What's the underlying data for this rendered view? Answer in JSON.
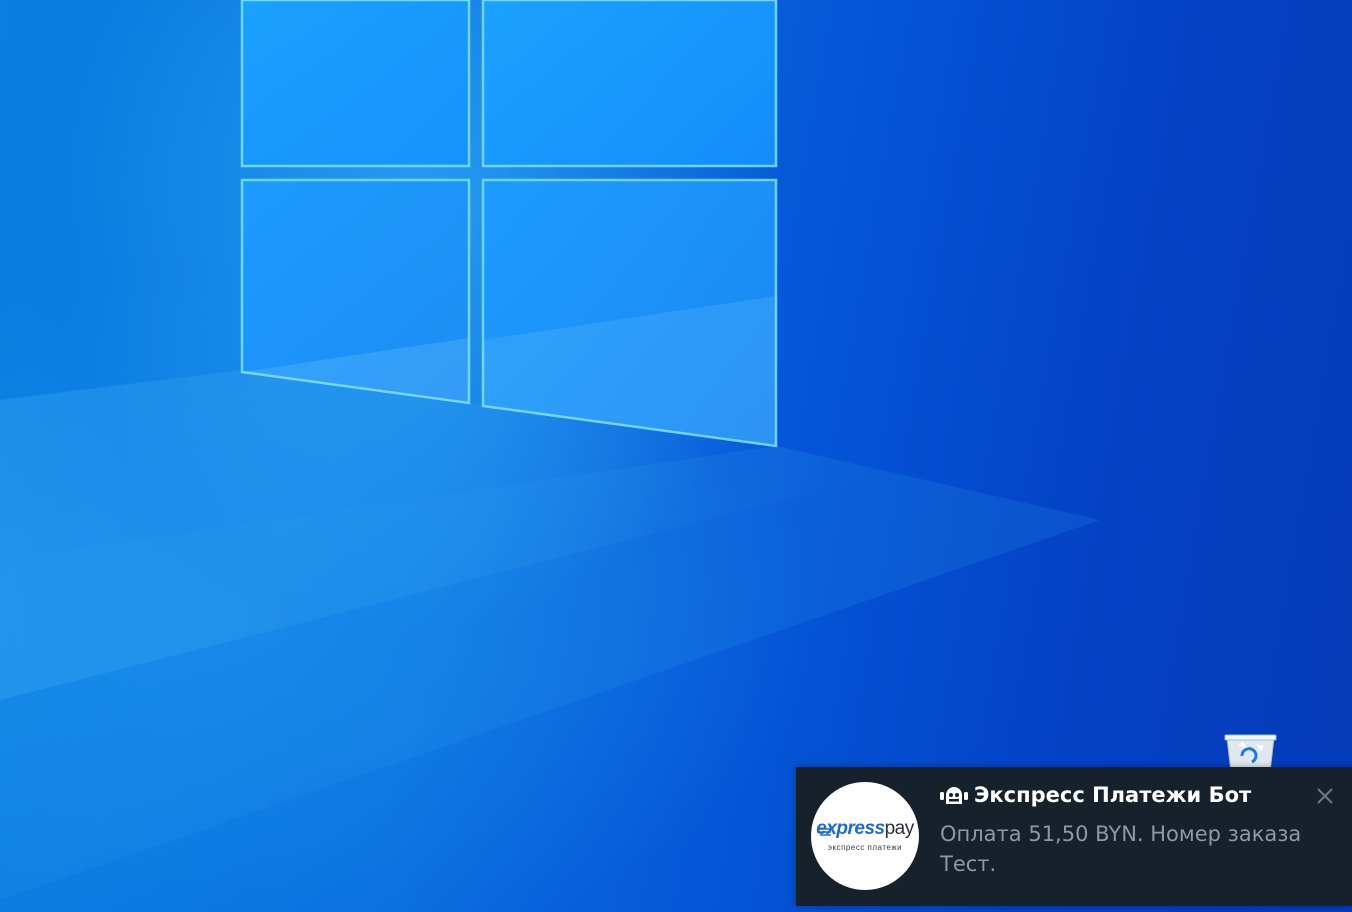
{
  "desktop": {
    "wallpaper": "windows-10-hero",
    "accent_color": "#0a6fe0"
  },
  "recycle_bin": {
    "icon": "recycle-bin-icon"
  },
  "notification": {
    "app_icon": "bot-icon",
    "title": "Экспресс Платежи Бот",
    "message": "Оплата 51,50 BYN. Номер заказа Тест.",
    "close_icon": "close-icon",
    "avatar": {
      "logo_primary": "express",
      "logo_secondary": "pay",
      "logo_tagline": "экспресс платежи"
    },
    "background_color": "#17212b",
    "title_color": "#ffffff",
    "message_color": "#8c99a6"
  }
}
